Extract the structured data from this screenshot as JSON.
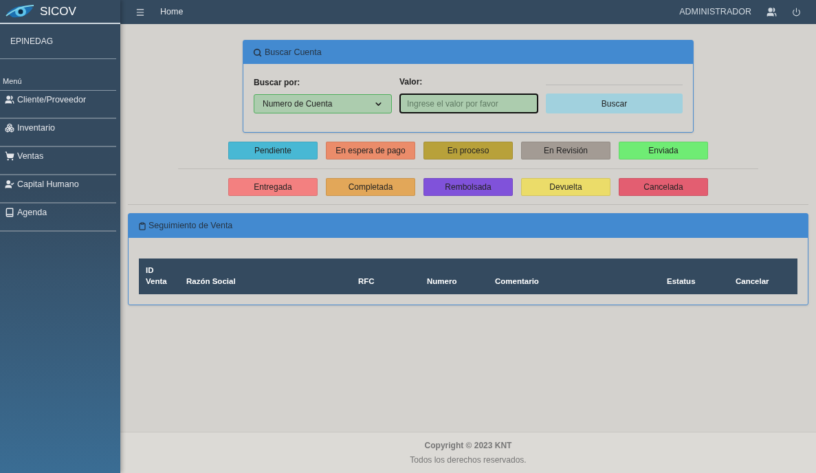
{
  "brand": {
    "name": "SICOV"
  },
  "topbar": {
    "breadcrumb": "Home",
    "user": "ADMINISTRADOR"
  },
  "sidebar": {
    "user": "EPINEDAG",
    "section": "Menú",
    "items": [
      {
        "label": "Cliente/Proveedor",
        "kind": "users"
      },
      {
        "label": "Inventario",
        "kind": "boxes"
      },
      {
        "label": "Ventas",
        "kind": "cart"
      },
      {
        "label": "Capital Humano",
        "kind": "usercheck"
      },
      {
        "label": "Agenda",
        "kind": "book"
      }
    ]
  },
  "search_card": {
    "title": "Buscar Cuenta",
    "search_by_label": "Buscar por:",
    "search_by_value": "Numero de Cuenta",
    "value_label": "Valor:",
    "value_placeholder": "Ingrese el valor por favor",
    "button": "Buscar"
  },
  "status_rows": [
    [
      {
        "label": "Pendiente",
        "color": "#48b8d4"
      },
      {
        "label": "En espera de pago",
        "color": "#eb8c6a"
      },
      {
        "label": "En proceso",
        "color": "#b8a13a"
      },
      {
        "label": "En Revisión",
        "color": "#a39b94"
      },
      {
        "label": "Enviada",
        "color": "#6fec74"
      }
    ],
    [
      {
        "label": "Entregada",
        "color": "#f38080"
      },
      {
        "label": "Completada",
        "color": "#e2a759"
      },
      {
        "label": "Rembolsada",
        "color": "#8052da"
      },
      {
        "label": "Devuelta",
        "color": "#ebdc69"
      },
      {
        "label": "Cancelada",
        "color": "#e35e71"
      }
    ]
  ],
  "tracking_card": {
    "title": "Seguimiento de Venta",
    "columns": [
      "ID Venta",
      "Razón Social",
      "RFC",
      "Numero",
      "Comentario",
      "Estatus",
      "Cancelar"
    ]
  },
  "footer": {
    "copyright": "Copyright © 2023 KNT",
    "rights": "Todos los derechos reservados."
  }
}
